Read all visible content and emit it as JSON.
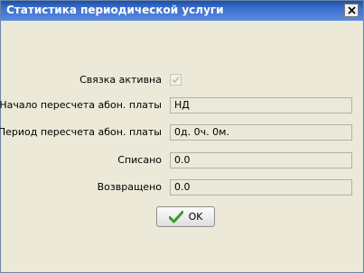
{
  "window": {
    "title": "Статистика периодической услуги",
    "close_icon": "close-icon"
  },
  "form": {
    "rows": [
      {
        "label": "Связка активна",
        "type": "checkbox",
        "checked": true
      },
      {
        "label": "Начало пересчета абон. платы",
        "value": "НД"
      },
      {
        "label": "Период пересчета абон. платы",
        "value": "0д. 0ч. 0м."
      },
      {
        "label": "Списано",
        "value": "0.0"
      },
      {
        "label": "Возвращено",
        "value": "0.0"
      }
    ]
  },
  "buttons": {
    "ok_label": "OK",
    "ok_icon": "checkmark-icon"
  },
  "colors": {
    "title_bar": "#3a6fd0",
    "dialog_bg": "#ece9d8",
    "checkmark": "#3c9a2a"
  }
}
